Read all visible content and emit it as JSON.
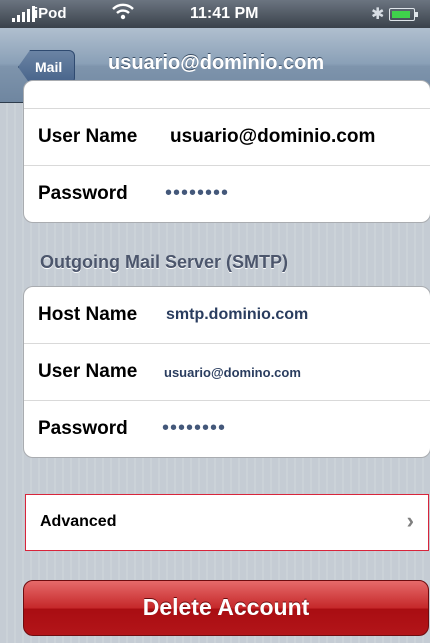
{
  "status_bar": {
    "carrier": "iPod",
    "time": "11:41 PM",
    "icons": [
      "signal-icon",
      "wifi-icon",
      "bluetooth-icon",
      "battery-icon"
    ]
  },
  "nav_bar": {
    "back_label": "Mail",
    "title": "usuario@dominio.com"
  },
  "incoming_group": {
    "rows": [
      {
        "label": "User Name",
        "value": "usuario@dominio.com"
      },
      {
        "label": "Password",
        "value": "••••••••"
      }
    ]
  },
  "outgoing_group": {
    "header": "Outgoing Mail Server (SMTP)",
    "rows": [
      {
        "label": "Host Name",
        "value": "smtp.dominio.com"
      },
      {
        "label": "User Name",
        "value": "usuario@domino.com"
      },
      {
        "label": "Password",
        "value": "••••••••"
      }
    ]
  },
  "advanced": {
    "label": "Advanced",
    "chevron": "›"
  },
  "delete_button": {
    "label": "Delete Account",
    "color": "#c5282a"
  }
}
